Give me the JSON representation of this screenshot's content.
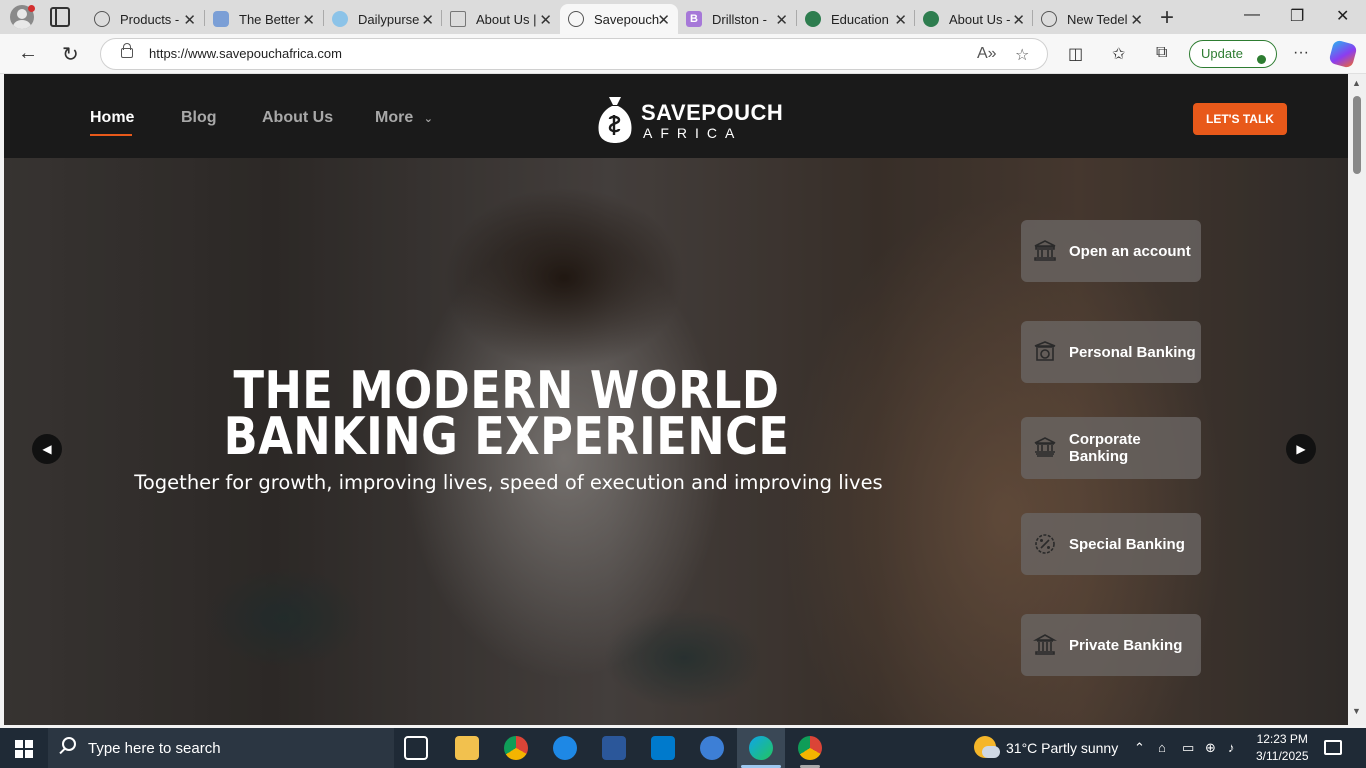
{
  "browser": {
    "tabs": [
      {
        "label": "Products -",
        "icon": "globe-icon",
        "active": false
      },
      {
        "label": "The Better",
        "icon": "site-icon",
        "active": false
      },
      {
        "label": "Dailypurse",
        "icon": "site-icon",
        "active": false
      },
      {
        "label": "About Us |",
        "icon": "document-icon",
        "active": false
      },
      {
        "label": "Savepouch",
        "icon": "globe-icon",
        "active": true
      },
      {
        "label": "Drillston -",
        "icon": "b-logo-icon",
        "active": false
      },
      {
        "label": "Education",
        "icon": "site-icon",
        "active": false
      },
      {
        "label": "About Us -",
        "icon": "site-icon",
        "active": false
      },
      {
        "label": "New Tedel",
        "icon": "globe-icon",
        "active": false
      }
    ],
    "url": "https://www.savepouchafrica.com",
    "update_label": "Update"
  },
  "site": {
    "nav": [
      {
        "label": "Home",
        "active": true
      },
      {
        "label": "Blog",
        "active": false
      },
      {
        "label": "About Us",
        "active": false
      },
      {
        "label": "More",
        "active": false
      }
    ],
    "logo_name": "SAVEPOUCH",
    "logo_sub": "AFRICA",
    "cta_label": "LET'S TALK",
    "accent_color": "#e8591a"
  },
  "hero": {
    "title_line1": "THE MODERN WORLD",
    "title_line2": "BANKING EXPERIENCE",
    "subtitle": "Together for growth, improving lives, speed of execution and improving lives",
    "prev_icon": "chevron-left-icon",
    "next_icon": "chevron-right-icon"
  },
  "services": [
    {
      "label": "Open an account",
      "icon": "bank-building-icon"
    },
    {
      "label": "Personal Banking",
      "icon": "bank-safe-icon"
    },
    {
      "label": "Corporate Banking",
      "icon": "corporate-bank-icon"
    },
    {
      "label": "Special Banking",
      "icon": "percent-badge-icon"
    },
    {
      "label": "Private Banking",
      "icon": "private-bank-icon"
    }
  ],
  "taskbar": {
    "search_placeholder": "Type here to search",
    "weather": "31°C  Partly sunny",
    "time": "12:23 PM",
    "date": "3/11/2025"
  }
}
